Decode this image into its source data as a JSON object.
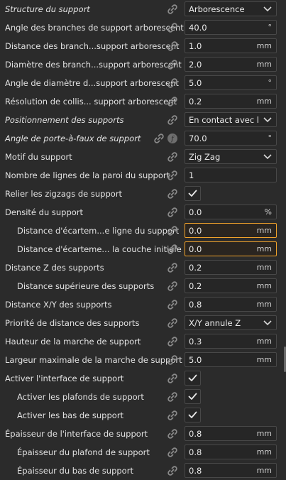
{
  "rows": [
    {
      "label": "Structure du support",
      "italic": true,
      "indent": false,
      "type": "select",
      "value": "Arborescence",
      "unit": "",
      "highlight": false
    },
    {
      "label": "Angle des branches de support arborescent",
      "italic": false,
      "indent": false,
      "type": "input",
      "value": "40.0",
      "unit": "°",
      "highlight": false
    },
    {
      "label": "Distance des branch...support arborescent",
      "italic": false,
      "indent": false,
      "type": "input",
      "value": "1.0",
      "unit": "mm",
      "highlight": false
    },
    {
      "label": "Diamètre des branch...support arborescent",
      "italic": false,
      "indent": false,
      "type": "input",
      "value": "2.0",
      "unit": "mm",
      "highlight": false
    },
    {
      "label": "Angle de diamètre d...support arborescent",
      "italic": false,
      "indent": false,
      "type": "input",
      "value": "5.0",
      "unit": "°",
      "highlight": false
    },
    {
      "label": "Résolution de collis... support arborescent",
      "italic": false,
      "indent": false,
      "type": "input",
      "value": "0.2",
      "unit": "mm",
      "highlight": false
    },
    {
      "label": "Positionnement des supports",
      "italic": true,
      "indent": false,
      "type": "select",
      "value": "En contact avec le...",
      "unit": "",
      "highlight": false
    },
    {
      "label": "Angle de porte-à-faux de support",
      "italic": true,
      "indent": false,
      "type": "input",
      "value": "70.0",
      "unit": "°",
      "highlight": false,
      "fx": true
    },
    {
      "label": "Motif du support",
      "italic": false,
      "indent": false,
      "type": "select",
      "value": "Zig Zag",
      "unit": "",
      "highlight": false
    },
    {
      "label": "Nombre de lignes de la paroi du support",
      "italic": false,
      "indent": false,
      "type": "input",
      "value": "1",
      "unit": "",
      "highlight": false
    },
    {
      "label": "Relier les zigzags de support",
      "italic": false,
      "indent": false,
      "type": "checkbox",
      "value": "",
      "unit": "",
      "highlight": false
    },
    {
      "label": "Densité du support",
      "italic": false,
      "indent": false,
      "type": "input",
      "value": "0.0",
      "unit": "%",
      "highlight": false
    },
    {
      "label": "Distance d'écartem...e ligne du support",
      "italic": false,
      "indent": true,
      "type": "input",
      "value": "0.0",
      "unit": "mm",
      "highlight": true
    },
    {
      "label": "Distance d'écarteme... la couche initiale",
      "italic": false,
      "indent": true,
      "type": "input",
      "value": "0.0",
      "unit": "mm",
      "highlight": true
    },
    {
      "label": "Distance Z des supports",
      "italic": false,
      "indent": false,
      "type": "input",
      "value": "0.2",
      "unit": "mm",
      "highlight": false
    },
    {
      "label": "Distance supérieure des supports",
      "italic": false,
      "indent": true,
      "type": "input",
      "value": "0.2",
      "unit": "mm",
      "highlight": false
    },
    {
      "label": "Distance X/Y des supports",
      "italic": false,
      "indent": false,
      "type": "input",
      "value": "0.8",
      "unit": "mm",
      "highlight": false
    },
    {
      "label": "Priorité de distance des supports",
      "italic": false,
      "indent": false,
      "type": "select",
      "value": "X/Y annule Z",
      "unit": "",
      "highlight": false
    },
    {
      "label": "Hauteur de la marche de support",
      "italic": false,
      "indent": false,
      "type": "input",
      "value": "0.3",
      "unit": "mm",
      "highlight": false
    },
    {
      "label": "Largeur maximale de la marche de support",
      "italic": false,
      "indent": false,
      "type": "input",
      "value": "5.0",
      "unit": "mm",
      "highlight": false
    },
    {
      "label": "Activer l'interface de support",
      "italic": false,
      "indent": false,
      "type": "checkbox",
      "value": "",
      "unit": "",
      "highlight": false
    },
    {
      "label": "Activer les plafonds de support",
      "italic": false,
      "indent": true,
      "type": "checkbox",
      "value": "",
      "unit": "",
      "highlight": false
    },
    {
      "label": "Activer les bas de support",
      "italic": false,
      "indent": true,
      "type": "checkbox",
      "value": "",
      "unit": "",
      "highlight": false
    },
    {
      "label": "Épaisseur de l'interface de support",
      "italic": false,
      "indent": false,
      "type": "input",
      "value": "0.8",
      "unit": "mm",
      "highlight": false
    },
    {
      "label": "Épaisseur du plafond de support",
      "italic": false,
      "indent": true,
      "type": "input",
      "value": "0.8",
      "unit": "mm",
      "highlight": false
    },
    {
      "label": "Épaisseur du bas de support",
      "italic": false,
      "indent": true,
      "type": "input",
      "value": "0.8",
      "unit": "mm",
      "highlight": false
    }
  ]
}
